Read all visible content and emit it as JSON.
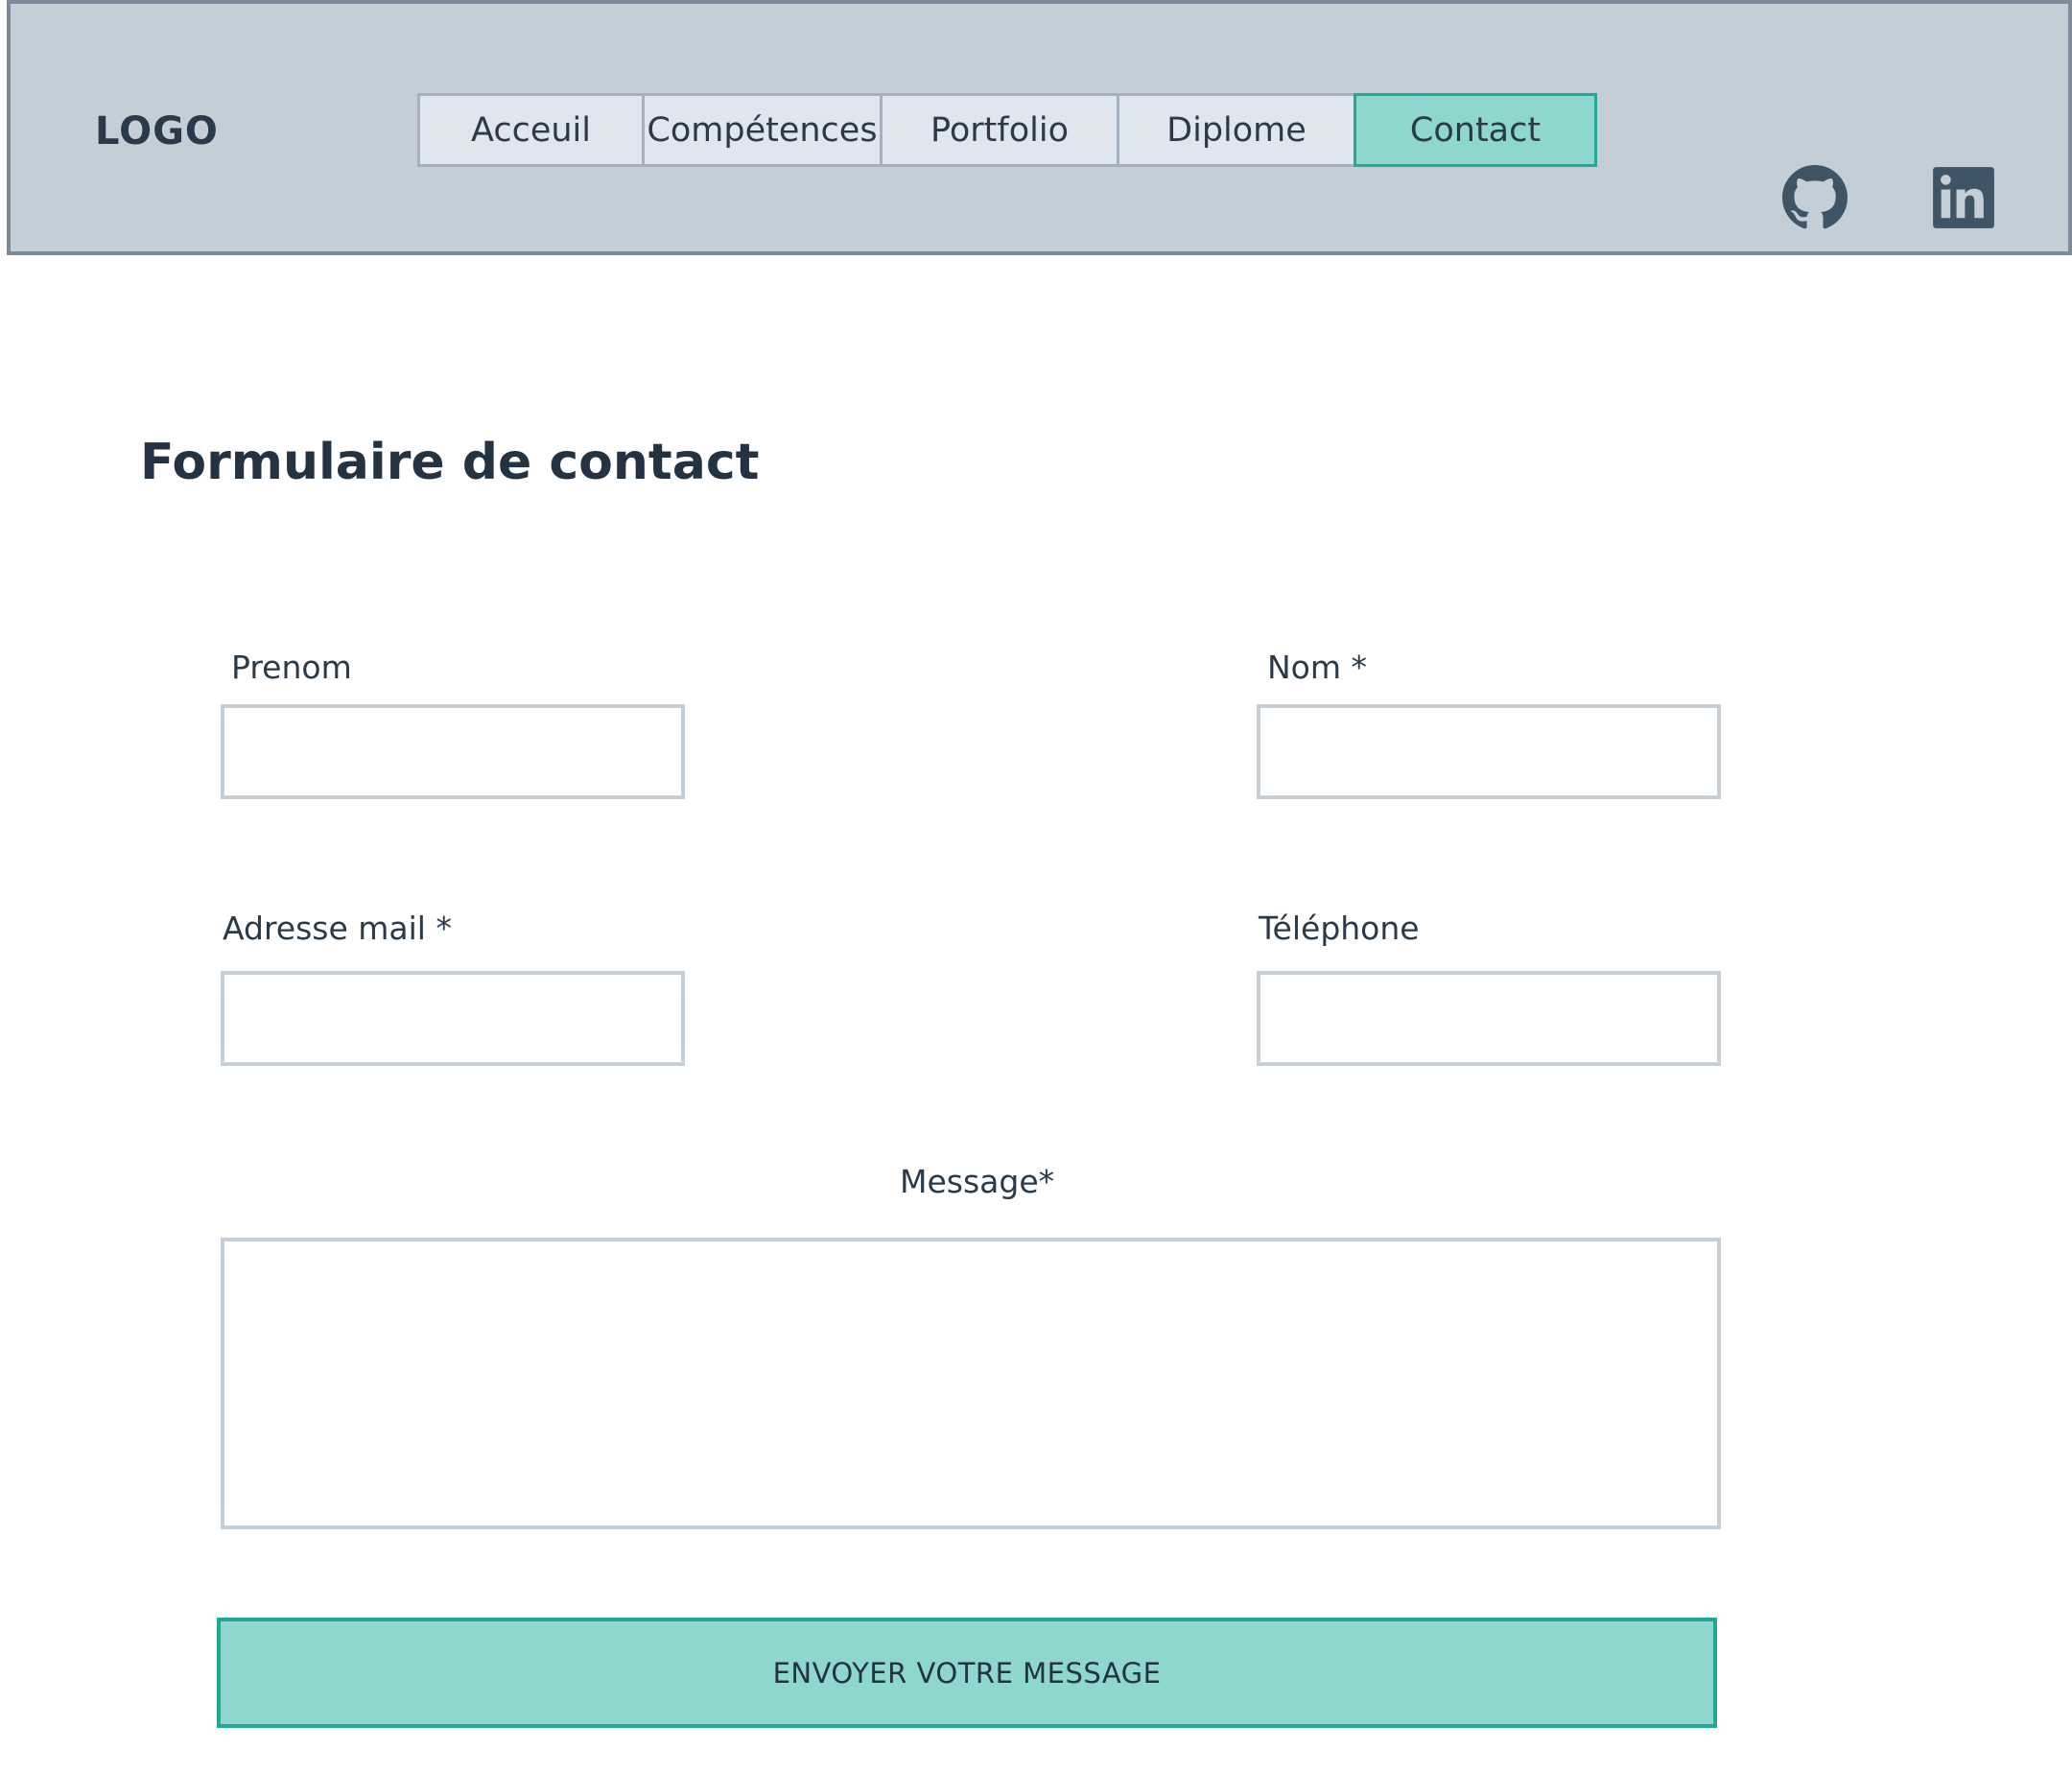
{
  "header": {
    "logo": "LOGO",
    "nav": [
      {
        "label": "Acceuil",
        "active": false
      },
      {
        "label": "Compétences",
        "active": false
      },
      {
        "label": "Portfolio",
        "active": false
      },
      {
        "label": "Diplome",
        "active": false
      },
      {
        "label": "Contact",
        "active": true
      }
    ],
    "social": [
      {
        "icon": "github-icon"
      },
      {
        "icon": "linkedin-icon"
      }
    ]
  },
  "form": {
    "title": "Formulaire de contact",
    "fields": {
      "prenom": {
        "label": "Prenom",
        "value": ""
      },
      "nom": {
        "label": "Nom *",
        "value": ""
      },
      "email": {
        "label": "Adresse mail *",
        "value": ""
      },
      "telephone": {
        "label": "Téléphone",
        "value": ""
      },
      "message": {
        "label": "Message*",
        "value": ""
      }
    },
    "submit_label": "ENVOYER VOTRE MESSAGE"
  },
  "colors": {
    "header_bg": "#c3ced7",
    "header_border": "#7b8b99",
    "nav_bg": "#e0e6ee",
    "accent": "#8ed7cd",
    "accent_border": "#22a899",
    "text": "#243342",
    "icon": "#3f5465"
  }
}
